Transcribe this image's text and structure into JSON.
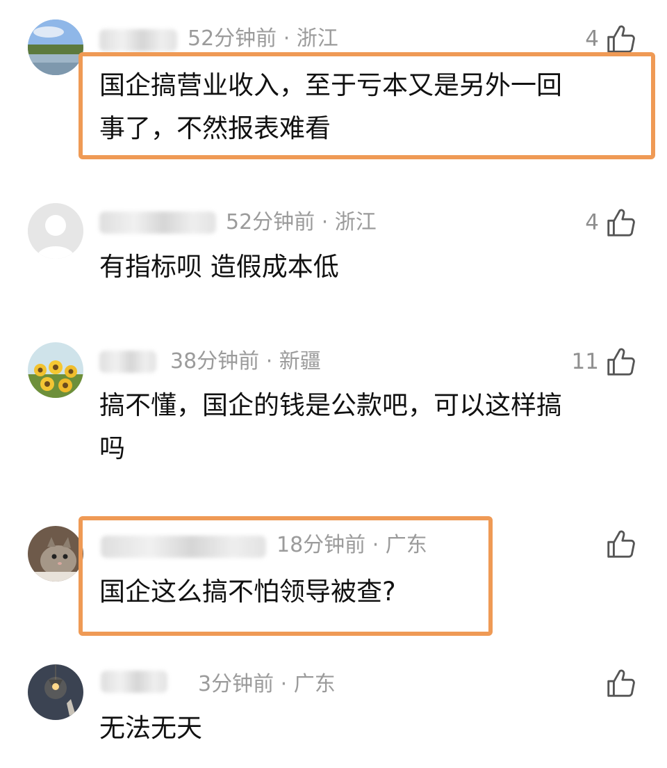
{
  "colors": {
    "highlight": "#ef9a55",
    "meta": "#9b9b9b",
    "text": "#111111"
  },
  "comments": [
    {
      "time": "52分钟前",
      "region": "浙江",
      "likes": "4",
      "lines": [
        "国企搞营业收入，至于亏本又是另外一回",
        "事了，不然报表难看"
      ],
      "avatar": "landscape-lake",
      "highlighted": true
    },
    {
      "time": "52分钟前",
      "region": "浙江",
      "likes": "4",
      "lines": [
        "有指标呗 造假成本低"
      ],
      "avatar": "default-user",
      "highlighted": false
    },
    {
      "time": "38分钟前",
      "region": "新疆",
      "likes": "11",
      "lines": [
        "搞不懂，国企的钱是公款吧，可以这样搞",
        "吗"
      ],
      "avatar": "sunflowers",
      "highlighted": false
    },
    {
      "time": "18分钟前",
      "region": "广东",
      "likes": "",
      "lines": [
        "国企这么搞不怕领导被查?"
      ],
      "avatar": "cat",
      "highlighted": true
    },
    {
      "time": "3分钟前",
      "region": "广东",
      "likes": "",
      "lines": [
        "无法无天"
      ],
      "avatar": "dark-lamp",
      "highlighted": false
    }
  ]
}
